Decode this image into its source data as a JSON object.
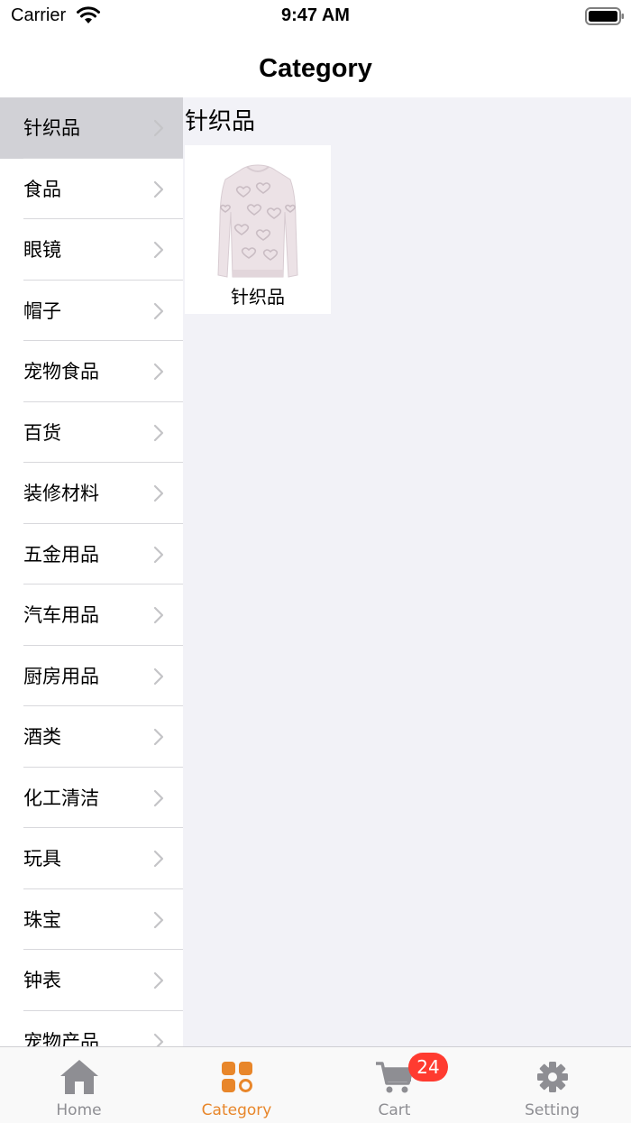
{
  "status": {
    "carrier": "Carrier",
    "time": "9:47 AM"
  },
  "nav": {
    "title": "Category"
  },
  "sidebar": {
    "selected_index": 0,
    "items": [
      {
        "label": "针织品"
      },
      {
        "label": "食品"
      },
      {
        "label": "眼镜"
      },
      {
        "label": "帽子"
      },
      {
        "label": "宠物食品"
      },
      {
        "label": "百货"
      },
      {
        "label": "装修材料"
      },
      {
        "label": "五金用品"
      },
      {
        "label": "汽车用品"
      },
      {
        "label": "厨房用品"
      },
      {
        "label": "酒类"
      },
      {
        "label": "化工清洁"
      },
      {
        "label": "玩具"
      },
      {
        "label": "珠宝"
      },
      {
        "label": "钟表"
      },
      {
        "label": "宠物产品"
      }
    ]
  },
  "content": {
    "section_title": "针织品",
    "products": [
      {
        "label": "针织品",
        "icon": "sweater-image"
      }
    ]
  },
  "tabbar": {
    "active_index": 1,
    "accent_color": "#e8862a",
    "inactive_color": "#8e8e93",
    "tabs": [
      {
        "label": "Home",
        "icon": "home-icon"
      },
      {
        "label": "Category",
        "icon": "category-icon"
      },
      {
        "label": "Cart",
        "icon": "cart-icon",
        "badge": "24"
      },
      {
        "label": "Setting",
        "icon": "gear-icon"
      }
    ]
  }
}
